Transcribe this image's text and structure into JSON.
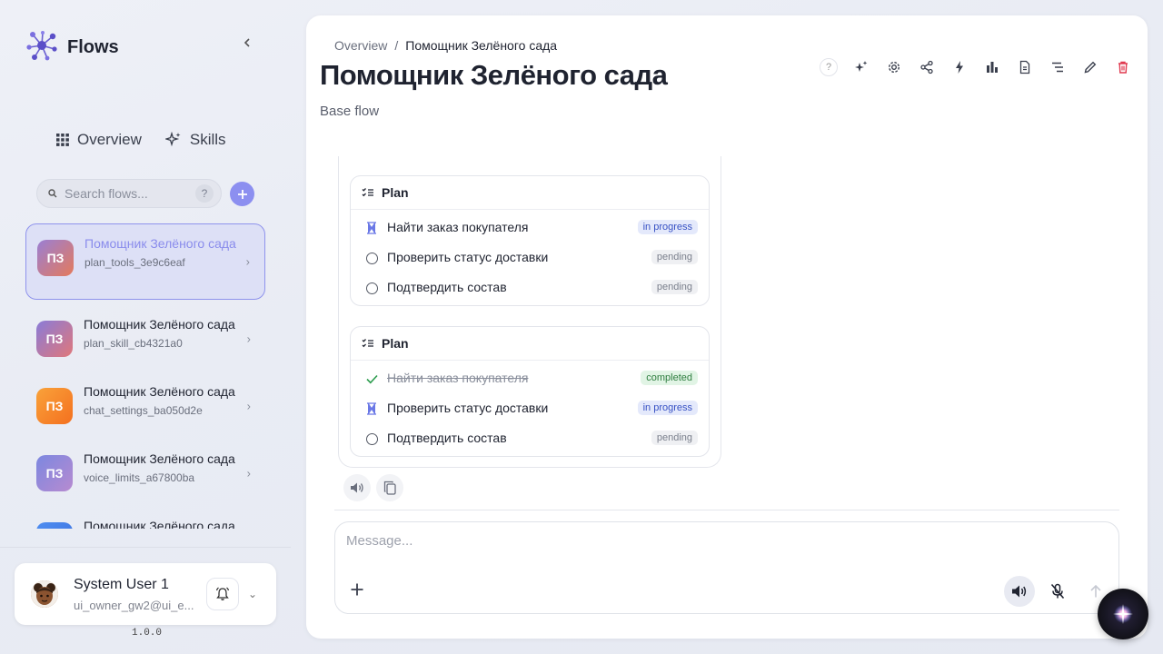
{
  "brand": {
    "name": "Flows",
    "accent": "#8c8ff0"
  },
  "nav": [
    {
      "label": "Overview",
      "icon": "grid-icon"
    },
    {
      "label": "Skills",
      "icon": "sparkle-icon"
    }
  ],
  "search": {
    "placeholder": "Search flows...",
    "help": "?"
  },
  "flows": [
    {
      "initials": "ПЗ",
      "title": "Помощник Зелёного сада",
      "sub": "plan_tools_3e9c6eaf",
      "active": true
    },
    {
      "initials": "ПЗ",
      "title": "Помощник Зелёного сада",
      "sub": "plan_skill_cb4321a0"
    },
    {
      "initials": "ПЗ",
      "title": "Помощник Зелёного сада",
      "sub": "chat_settings_ba050d2e"
    },
    {
      "initials": "ПЗ",
      "title": "Помощник Зелёного сада",
      "sub": "voice_limits_a67800ba"
    },
    {
      "initials": "",
      "title": "Помощник Зелёного сада",
      "sub": ""
    }
  ],
  "user": {
    "name": "System User 1",
    "email": "ui_owner_gw2@ui_e..."
  },
  "version": "1.0.0",
  "breadcrumb": {
    "root": "Overview",
    "sep": "/",
    "current": "Помощник Зелёного сада"
  },
  "page": {
    "title": "Помощник Зелёного сада",
    "subtitle": "Base flow"
  },
  "toolbar": {
    "help": "?"
  },
  "plans": [
    {
      "title": "Plan",
      "steps": [
        {
          "label": "Найти заказ покупателя",
          "status": "in progress"
        },
        {
          "label": "Проверить статус доставки",
          "status": "pending"
        },
        {
          "label": "Подтвердить состав",
          "status": "pending"
        }
      ]
    },
    {
      "title": "Plan",
      "steps": [
        {
          "label": "Найти заказ покупателя",
          "status": "completed"
        },
        {
          "label": "Проверить статус доставки",
          "status": "in progress"
        },
        {
          "label": "Подтвердить состав",
          "status": "pending"
        }
      ]
    }
  ],
  "composer": {
    "placeholder": "Message..."
  }
}
